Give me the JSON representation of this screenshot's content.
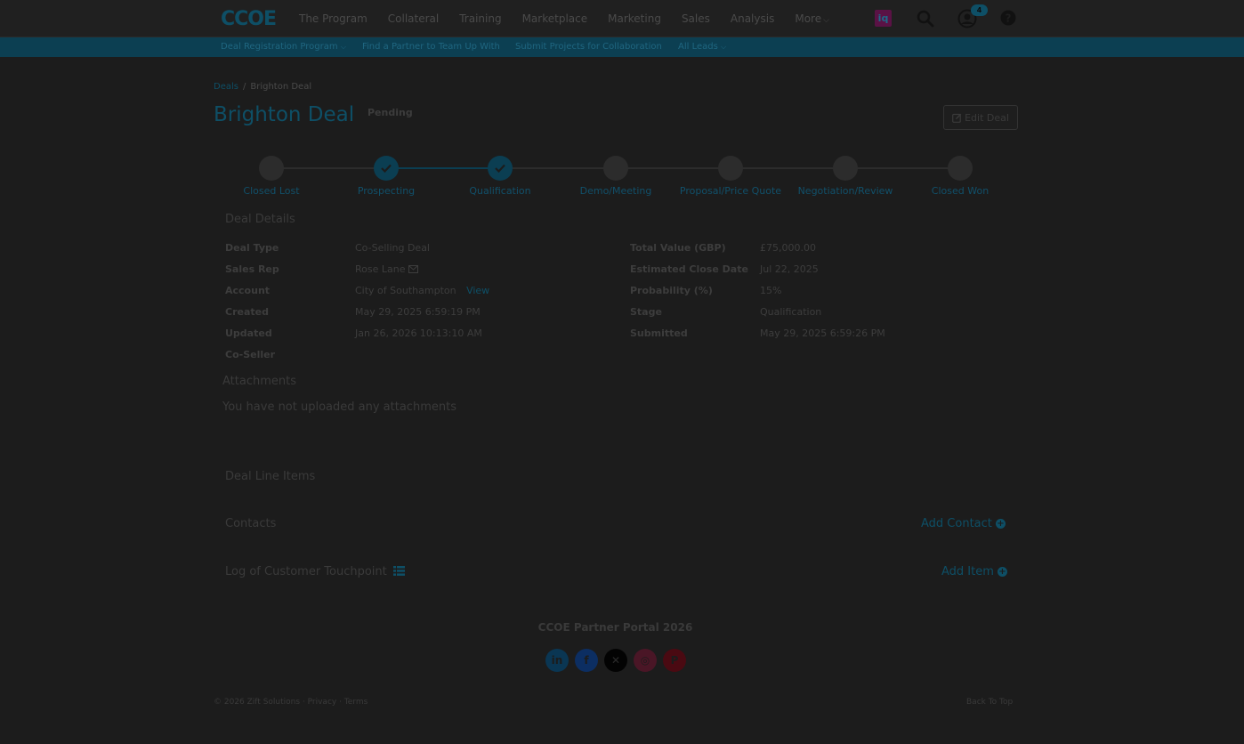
{
  "nav": {
    "logo_text": "CCOE",
    "items": [
      "The Program",
      "Collateral",
      "Training",
      "Marketplace",
      "Marketing",
      "Sales",
      "Analysis",
      "More"
    ],
    "iq_label": "iq",
    "notification_count": "4"
  },
  "subnav": {
    "items": [
      "Deal Registration Program",
      "Find a Partner to Team Up With",
      "Submit Projects for Collaboration",
      "All Leads"
    ]
  },
  "breadcrumb": {
    "parent": "Deals",
    "separator": "/",
    "current": "Brighton Deal"
  },
  "deal": {
    "title": "Brighton Deal",
    "status": "Pending",
    "edit_label": "Edit Deal"
  },
  "stages": {
    "steps": [
      "Closed Lost",
      "Prospecting",
      "Qualification",
      "Demo/Meeting",
      "Proposal/Price Quote",
      "Negotiation/Review",
      "Closed Won"
    ],
    "completed": [
      1,
      2
    ]
  },
  "details": {
    "heading": "Deal Details",
    "left": [
      {
        "label": "Deal Type",
        "value": "Co-Selling Deal"
      },
      {
        "label": "Sales Rep",
        "value": "Rose Lane"
      },
      {
        "label": "Account",
        "value": "City of Southampton",
        "link": "View"
      },
      {
        "label": "Created",
        "value": "May 29, 2025 6:59:19 PM"
      },
      {
        "label": "Updated",
        "value": "Jan 26, 2026 10:13:10 AM"
      },
      {
        "label": "Co-Seller",
        "value": ""
      }
    ],
    "right": [
      {
        "label": "Total Value (GBP)",
        "value": "£75,000.00"
      },
      {
        "label": "Estimated Close Date",
        "value": "Jul 22, 2025"
      },
      {
        "label": "Probability (%)",
        "value": "15%"
      },
      {
        "label": "Stage",
        "value": "Qualification"
      },
      {
        "label": "Submitted",
        "value": "May 29, 2025 6:59:26 PM"
      }
    ]
  },
  "attachments": {
    "heading": "Attachments",
    "empty_text": "You have not uploaded any attachments"
  },
  "line_items": {
    "heading": "Deal Line Items"
  },
  "contacts": {
    "heading": "Contacts",
    "add_label": "Add Contact"
  },
  "touchpoints": {
    "heading": "Log of Customer Touchpoint",
    "add_label": "Add Item"
  },
  "footer": {
    "title": "CCOE Partner Portal 2026",
    "social": [
      "linkedin-icon",
      "facebook-icon",
      "x-icon",
      "instagram-icon",
      "pinterest-icon"
    ],
    "copyright": "© 2026 Zift Solutions",
    "privacy": "Privacy",
    "terms": "Terms",
    "back_to_top": "Back To Top"
  },
  "colors": {
    "overlay_bg": "#1c1c1c",
    "brand_dark": "#0e4f66",
    "subnav_bg": "#0c3f52"
  }
}
